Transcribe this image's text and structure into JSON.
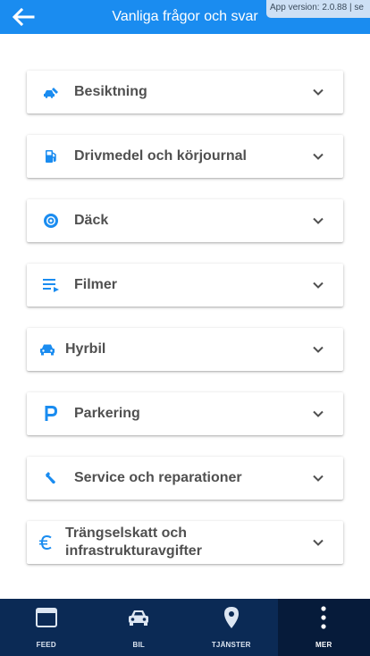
{
  "header": {
    "title": "Vanliga frågor och svar",
    "back_icon": "arrow-left-icon",
    "version": "App version: 2.0.88 | se"
  },
  "colors": {
    "header": "#1a8cf0",
    "icon": "#1a8cf0",
    "text": "#505050",
    "nav_bg": "#0b2a55",
    "nav_active": "#061b3a"
  },
  "faq": [
    {
      "label": "Besiktning",
      "icon": "car-inspection-icon"
    },
    {
      "label": "Drivmedel och körjournal",
      "icon": "fuel-pump-icon"
    },
    {
      "label": "Däck",
      "icon": "tire-icon"
    },
    {
      "label": "Filmer",
      "icon": "playlist-icon"
    },
    {
      "label": "Hyrbil",
      "icon": "car-icon"
    },
    {
      "label": "Parkering",
      "icon": "parking-icon"
    },
    {
      "label": "Service och reparationer",
      "icon": "wrench-icon"
    },
    {
      "label": "Trängselskatt och infrastrukturavgifter",
      "icon": "euro-icon"
    }
  ],
  "nav": [
    {
      "label": "FEED",
      "icon": "feed-icon",
      "active": false
    },
    {
      "label": "BIL",
      "icon": "car-icon",
      "active": false
    },
    {
      "label": "TJÄNSTER",
      "icon": "location-pin-icon",
      "active": false
    },
    {
      "label": "MER",
      "icon": "more-vertical-icon",
      "active": true
    }
  ]
}
